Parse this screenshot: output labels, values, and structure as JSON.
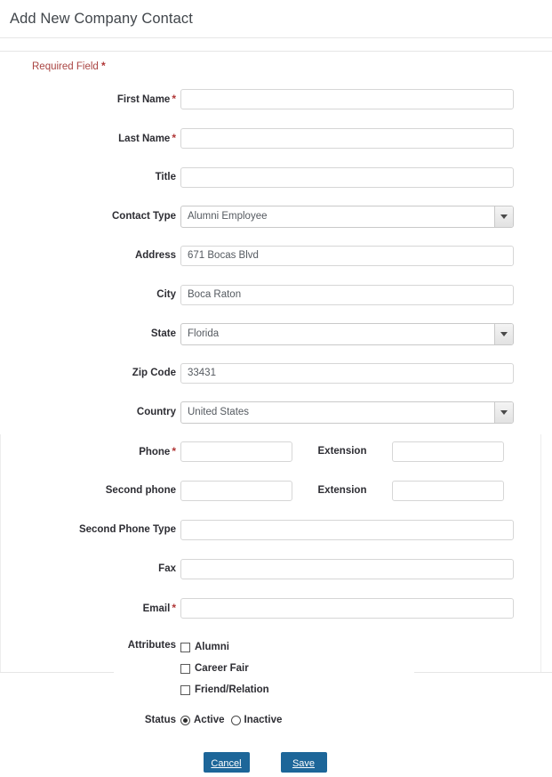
{
  "header": {
    "title": "Add New Company Contact"
  },
  "form": {
    "required_note": "Required Field",
    "required_marker": "*",
    "fields": [
      {
        "label": "First Name",
        "required": true,
        "type": "text",
        "value": ""
      },
      {
        "label": "Last Name",
        "required": true,
        "type": "text",
        "value": ""
      },
      {
        "label": "Title",
        "required": false,
        "type": "text",
        "value": ""
      },
      {
        "label": "Contact Type",
        "required": false,
        "type": "select",
        "value": "Alumni Employee"
      },
      {
        "label": "Address",
        "required": false,
        "type": "text",
        "value": "671 Bocas Blvd"
      },
      {
        "label": "City",
        "required": false,
        "type": "text",
        "value": "Boca Raton"
      },
      {
        "label": "State",
        "required": false,
        "type": "select",
        "value": "Florida"
      },
      {
        "label": "Zip Code",
        "required": false,
        "type": "text",
        "value": "33431"
      },
      {
        "label": "Country",
        "required": false,
        "type": "select",
        "value": "United States"
      }
    ],
    "phone_row": {
      "label": "Phone",
      "required": true,
      "value": "",
      "extension_label": "Extension",
      "extension_value": ""
    },
    "second_phone_row": {
      "label": "Second phone",
      "required": false,
      "value": "",
      "extension_label": "Extension",
      "extension_value": ""
    },
    "tail_fields": [
      {
        "label": "Second Phone Type",
        "required": false,
        "type": "text",
        "value": ""
      },
      {
        "label": "Fax",
        "required": false,
        "type": "text",
        "value": ""
      },
      {
        "label": "Email",
        "required": true,
        "type": "text",
        "value": ""
      }
    ],
    "attributes": {
      "label": "Attributes",
      "items": [
        {
          "label": "Alumni",
          "checked": false
        },
        {
          "label": "Career Fair",
          "checked": false
        },
        {
          "label": "Friend/Relation",
          "checked": false
        }
      ]
    },
    "status": {
      "label": "Status",
      "options": [
        {
          "label": "Active",
          "selected": true
        },
        {
          "label": "Inactive",
          "selected": false
        }
      ]
    },
    "buttons": {
      "cancel_label": "Cancel",
      "save_label": "Save"
    }
  },
  "colors": {
    "button_blue": "#1d6699",
    "required_red": "#b03636",
    "title_gray": "#41464b"
  }
}
